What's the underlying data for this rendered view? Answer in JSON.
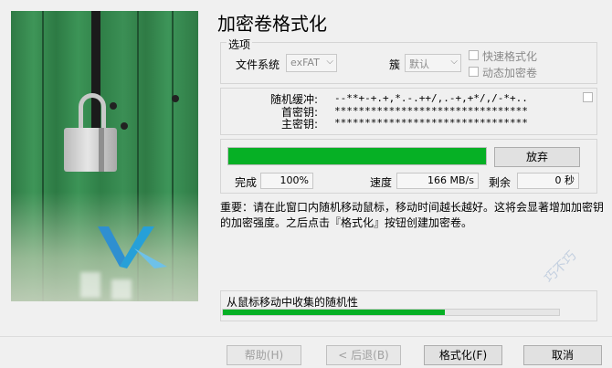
{
  "title": "加密卷格式化",
  "options": {
    "legend": "选项",
    "filesystem_label": "文件系统",
    "filesystem_value": "exFAT",
    "cluster_label": "簇",
    "cluster_value": "默认",
    "quick_format_label": "快速格式化",
    "dynamic_label": "动态加密卷"
  },
  "pool": {
    "random_label": "随机缓冲:",
    "random_value": "--**+-+.+,*.-.++/,.-+,+*/,/-*+..",
    "header_key_label": "首密钥:",
    "header_key_value": "********************************",
    "master_key_label": "主密钥:",
    "master_key_value": "********************************"
  },
  "progress": {
    "percent": 100,
    "abort_label": "放弃",
    "done_label": "完成",
    "done_value": "100%",
    "speed_label": "速度",
    "speed_value": "166 MB/s",
    "left_label": "剩余",
    "left_value": "0 秒"
  },
  "notice": "重要：请在此窗口内随机移动鼠标，移动时间越长越好。这将会显著增加加密钥的加密强度。之后点击『格式化』按钮创建加密卷。",
  "collection": {
    "label": "从鼠标移动中收集的随机性",
    "percent": 66
  },
  "buttons": {
    "help": "帮助(H)",
    "back": "< 后退(B)",
    "format": "格式化(F)",
    "cancel": "取消"
  },
  "watermark": "巧不巧"
}
